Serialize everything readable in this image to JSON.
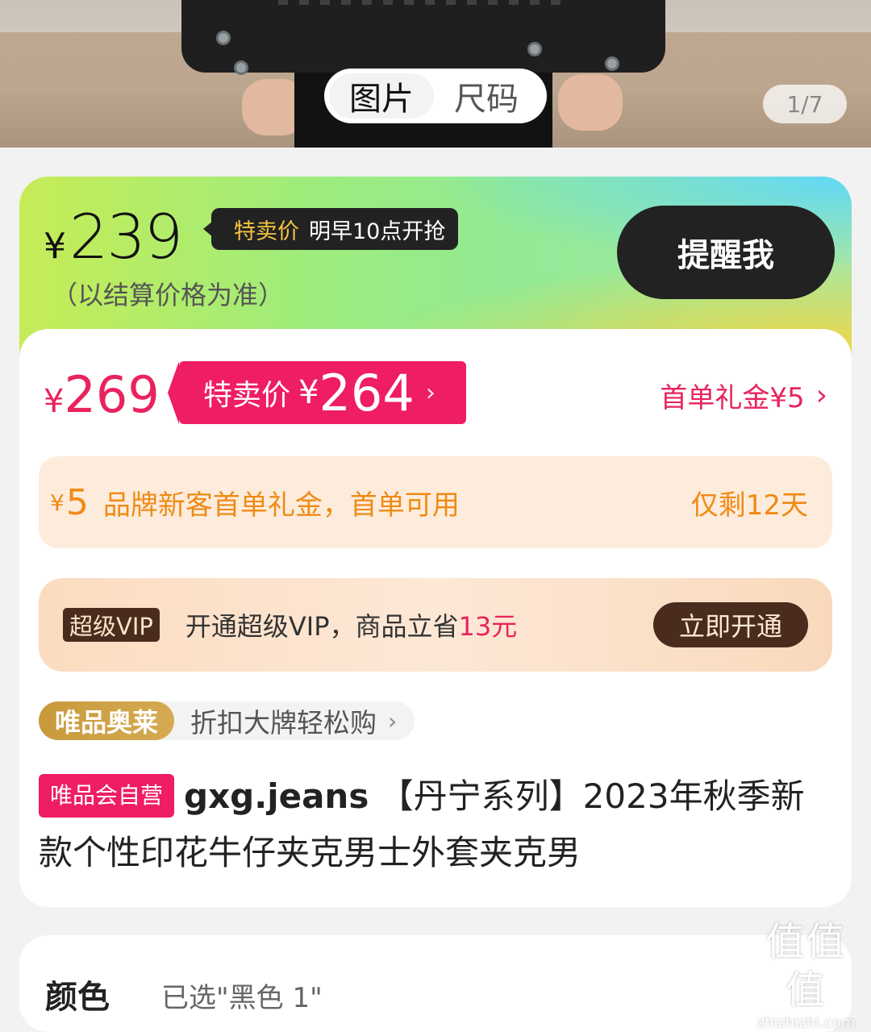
{
  "hero": {
    "tabs": [
      {
        "label": "图片",
        "active": true
      },
      {
        "label": "尺码",
        "active": false
      }
    ],
    "counter": "1/7"
  },
  "price_header": {
    "currency": "¥",
    "price": "239",
    "tag_label": "特卖价",
    "tag_time": "明早10点开抢",
    "note": "（以结算价格为准）",
    "remind_button": "提醒我"
  },
  "current_price": {
    "currency": "¥",
    "original": "269",
    "promo_label": "特卖价",
    "promo_currency": "¥",
    "promo_price": "264",
    "promo_chevron": "›",
    "first_order_gift": "首单礼金¥5",
    "first_order_chevron": "›"
  },
  "coupon": {
    "currency": "¥",
    "amount": "5",
    "text": "品牌新客首单礼金，首单可用",
    "remaining": "仅剩12天"
  },
  "vip": {
    "badge": "超级VIP",
    "text_prefix": "开通超级VIP，商品立省",
    "amount": "13元",
    "button": "立即开通"
  },
  "outlet": {
    "badge": "唯品奥莱",
    "text": "折扣大牌轻松购",
    "chevron": "›"
  },
  "product": {
    "self_badge": "唯品会自营",
    "brand": "gxg.jeans",
    "title": " 【丹宁系列】2023年秋季新款个性印花牛仔夹克男士外套夹克男"
  },
  "spec": {
    "label": "颜色",
    "value": "已选\"黑色 1\""
  },
  "watermark": {
    "logo": "值值值",
    "url": "zhizhizhi.com"
  }
}
